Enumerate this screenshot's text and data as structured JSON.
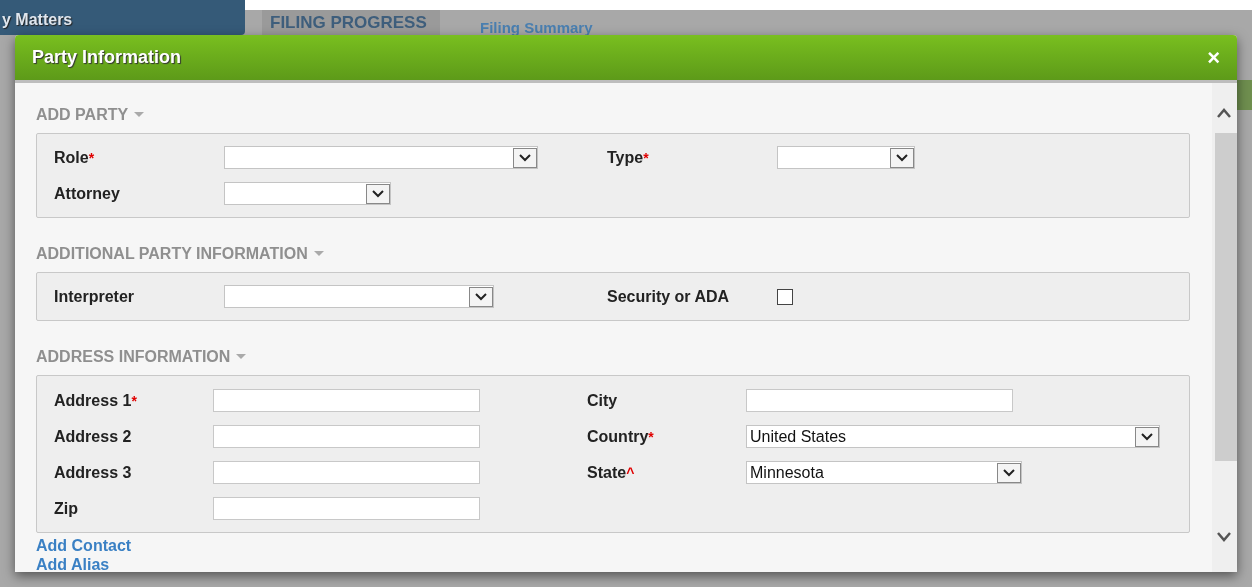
{
  "background": {
    "tabs": [
      {
        "label": "y Matters",
        "selected": true
      },
      {
        "label": "FILING PROGRESS",
        "selected": false
      }
    ],
    "link": "Filing Summary"
  },
  "dialog": {
    "title": "Party Information",
    "close": "×",
    "sections": [
      {
        "title": "ADD PARTY",
        "rows": [
          [
            {
              "label": "Role",
              "required": "*",
              "kind": "select"
            },
            {
              "label": "Type",
              "required": "*",
              "kind": "select"
            }
          ],
          [
            {
              "label": "Attorney",
              "kind": "select"
            }
          ]
        ]
      },
      {
        "title": "ADDITIONAL PARTY INFORMATION",
        "rows": [
          [
            {
              "label": "Interpreter",
              "kind": "select"
            },
            {
              "label": "Security or ADA",
              "kind": "checkbox",
              "checked": false
            }
          ]
        ]
      },
      {
        "title": "ADDRESS INFORMATION",
        "rows": [
          [
            {
              "label": "Address 1",
              "required": "*",
              "kind": "text"
            },
            {
              "label": "City",
              "kind": "text"
            }
          ],
          [
            {
              "label": "Address 2",
              "kind": "text"
            },
            {
              "label": "Country",
              "required": "*",
              "kind": "select",
              "value": "United States"
            }
          ],
          [
            {
              "label": "Address 3",
              "kind": "text"
            },
            {
              "label": "State",
              "required": "^",
              "kind": "select",
              "value": "Minnesota"
            }
          ],
          [
            {
              "label": "Zip",
              "kind": "text"
            }
          ]
        ]
      }
    ],
    "links": [
      "Add Contact",
      "Add Alias"
    ]
  }
}
